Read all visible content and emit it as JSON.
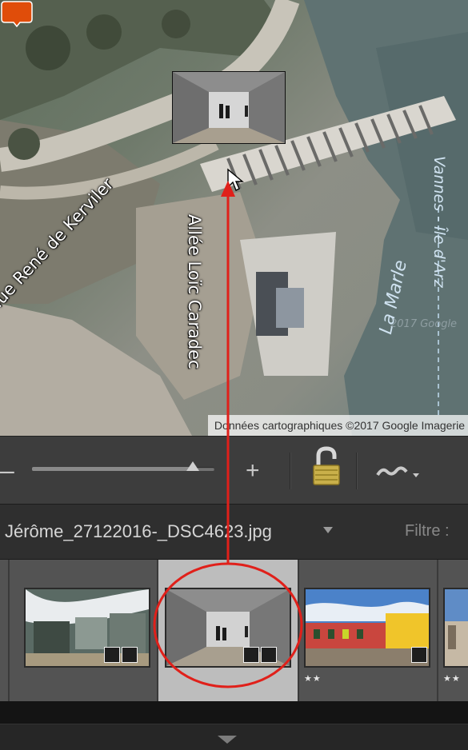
{
  "map": {
    "street_1": "nue René de Kerviler",
    "street_2": "Allée Loïc Caradec",
    "water_1": "La Marle",
    "water_2": "Vannes - Île d'Arz",
    "faint_label": "2017 Google",
    "attribution": "Données cartographiques ©2017 Google Imagerie"
  },
  "toolbar": {
    "zoom_out": "–",
    "zoom_in": "+",
    "zoom_level": 0.88,
    "lock_icon": "padlock-unlocked-icon",
    "track_icon": "gps-track-icon"
  },
  "filmstrip": {
    "filename": "Jérôme_27122016-_DSC4623.jpg",
    "filter_label": "Filtre :",
    "items": [
      {
        "stars": "",
        "selected": false
      },
      {
        "stars": "",
        "selected": true
      },
      {
        "stars": "★★",
        "selected": false
      },
      {
        "stars": "★★",
        "selected": false
      }
    ]
  },
  "colors": {
    "pin": "#e04d0a",
    "annotation": "#e0201a",
    "selected_cell": "#bdbdbd"
  }
}
